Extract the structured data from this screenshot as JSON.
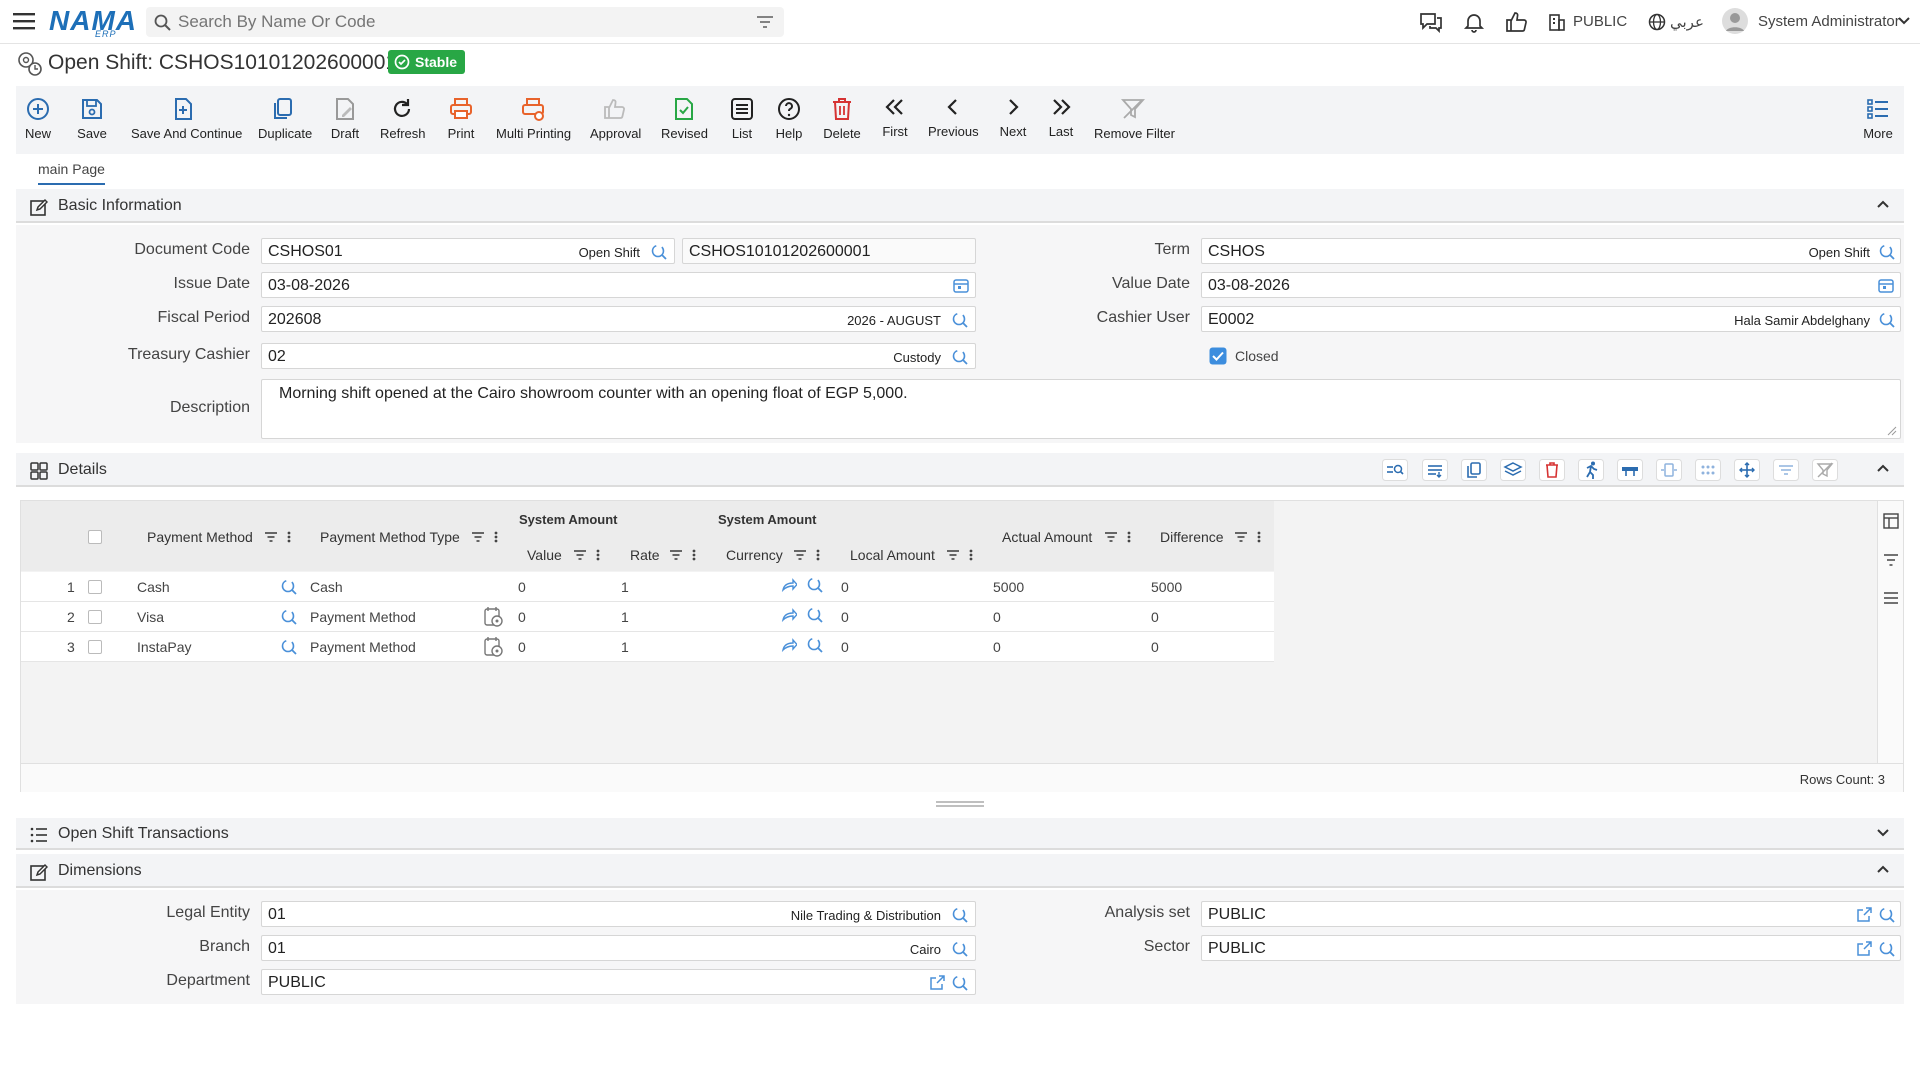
{
  "app": {
    "brand": "NAMA",
    "brand_sub": "ERP",
    "search_placeholder": "Search By Name Or Code",
    "company": "PUBLIC",
    "language": "عربي",
    "user": "System Administrator"
  },
  "page": {
    "title": "Open Shift: CSHOS10101202600001",
    "status": "Stable"
  },
  "toolbar": [
    {
      "label": "New",
      "icon": "plus-circle-icon",
      "color": "#2b6cb0"
    },
    {
      "label": "Save",
      "icon": "save-icon",
      "color": "#2b6cb0"
    },
    {
      "label": "Save And Continue",
      "icon": "save-continue-icon",
      "color": "#2b6cb0"
    },
    {
      "label": "Duplicate",
      "icon": "duplicate-icon",
      "color": "#2b6cb0"
    },
    {
      "label": "Draft",
      "icon": "draft-icon",
      "color": "#999999"
    },
    {
      "label": "Refresh",
      "icon": "refresh-icon",
      "color": "#222222"
    },
    {
      "label": "Print",
      "icon": "print-icon",
      "color": "#e8632b"
    },
    {
      "label": "Multi Printing",
      "icon": "multi-print-icon",
      "color": "#e8632b"
    },
    {
      "label": "Approval",
      "icon": "thumbs-up-icon",
      "color": "#aaaaaa"
    },
    {
      "label": "Revised",
      "icon": "revised-icon",
      "color": "#28a745"
    },
    {
      "label": "List",
      "icon": "list-icon",
      "color": "#222222"
    },
    {
      "label": "Help",
      "icon": "help-icon",
      "color": "#222222"
    },
    {
      "label": "Delete",
      "icon": "trash-icon",
      "color": "#d63333"
    },
    {
      "label": "First",
      "icon": "first-icon",
      "color": "#222222"
    },
    {
      "label": "Previous",
      "icon": "previous-icon",
      "color": "#222222"
    },
    {
      "label": "Next",
      "icon": "next-icon",
      "color": "#222222"
    },
    {
      "label": "Last",
      "icon": "last-icon",
      "color": "#222222"
    },
    {
      "label": "Remove Filter",
      "icon": "remove-filter-icon",
      "color": "#999999"
    }
  ],
  "toolbar_more": "More",
  "tabs": [
    {
      "label": "main Page"
    }
  ],
  "basic": {
    "title": "Basic Information",
    "document_code": {
      "label": "Document Code",
      "value": "CSHOS01",
      "desc": "Open Shift",
      "code": "CSHOS10101202600001"
    },
    "issue_date": {
      "label": "Issue Date",
      "value": "03-08-2026"
    },
    "fiscal_period": {
      "label": "Fiscal Period",
      "value": "202608",
      "desc": "2026 - AUGUST"
    },
    "treasury_cashier": {
      "label": "Treasury Cashier",
      "value": "02",
      "desc": "Custody"
    },
    "description": {
      "label": "Description",
      "value": "Morning shift opened at the Cairo showroom counter with an opening float of EGP 5,000."
    },
    "term": {
      "label": "Term",
      "value": "CSHOS",
      "desc": "Open Shift"
    },
    "value_date": {
      "label": "Value Date",
      "value": "03-08-2026"
    },
    "cashier_user": {
      "label": "Cashier User",
      "value": "E0002",
      "desc": "Hala Samir Abdelghany"
    },
    "closed": {
      "label": "Closed",
      "checked": true
    }
  },
  "details": {
    "title": "Details",
    "group_headers": [
      "System Amount",
      "System Amount"
    ],
    "columns": [
      "Payment Method",
      "Payment Method Type",
      "Value",
      "Rate",
      "Currency",
      "Local Amount",
      "Actual Amount",
      "Difference"
    ],
    "rows": [
      {
        "n": "1",
        "method": "Cash",
        "type": "Cash",
        "value": "0",
        "rate": "1",
        "local": "0",
        "actual": "5000",
        "diff": "5000"
      },
      {
        "n": "2",
        "method": "Visa",
        "type": "Payment Method",
        "value": "0",
        "rate": "1",
        "local": "0",
        "actual": "0",
        "diff": "0"
      },
      {
        "n": "3",
        "method": "InstaPay",
        "type": "Payment Method",
        "value": "0",
        "rate": "1",
        "local": "0",
        "actual": "0",
        "diff": "0"
      }
    ],
    "rows_count": "Rows Count: 3"
  },
  "transactions": {
    "title": "Open Shift Transactions"
  },
  "dimensions": {
    "title": "Dimensions",
    "legal_entity": {
      "label": "Legal Entity",
      "value": "01",
      "desc": "Nile Trading & Distribution"
    },
    "branch": {
      "label": "Branch",
      "value": "01",
      "desc": "Cairo"
    },
    "department": {
      "label": "Department",
      "value": "PUBLIC"
    },
    "analysis_set": {
      "label": "Analysis set",
      "value": "PUBLIC"
    },
    "sector": {
      "label": "Sector",
      "value": "PUBLIC"
    }
  }
}
